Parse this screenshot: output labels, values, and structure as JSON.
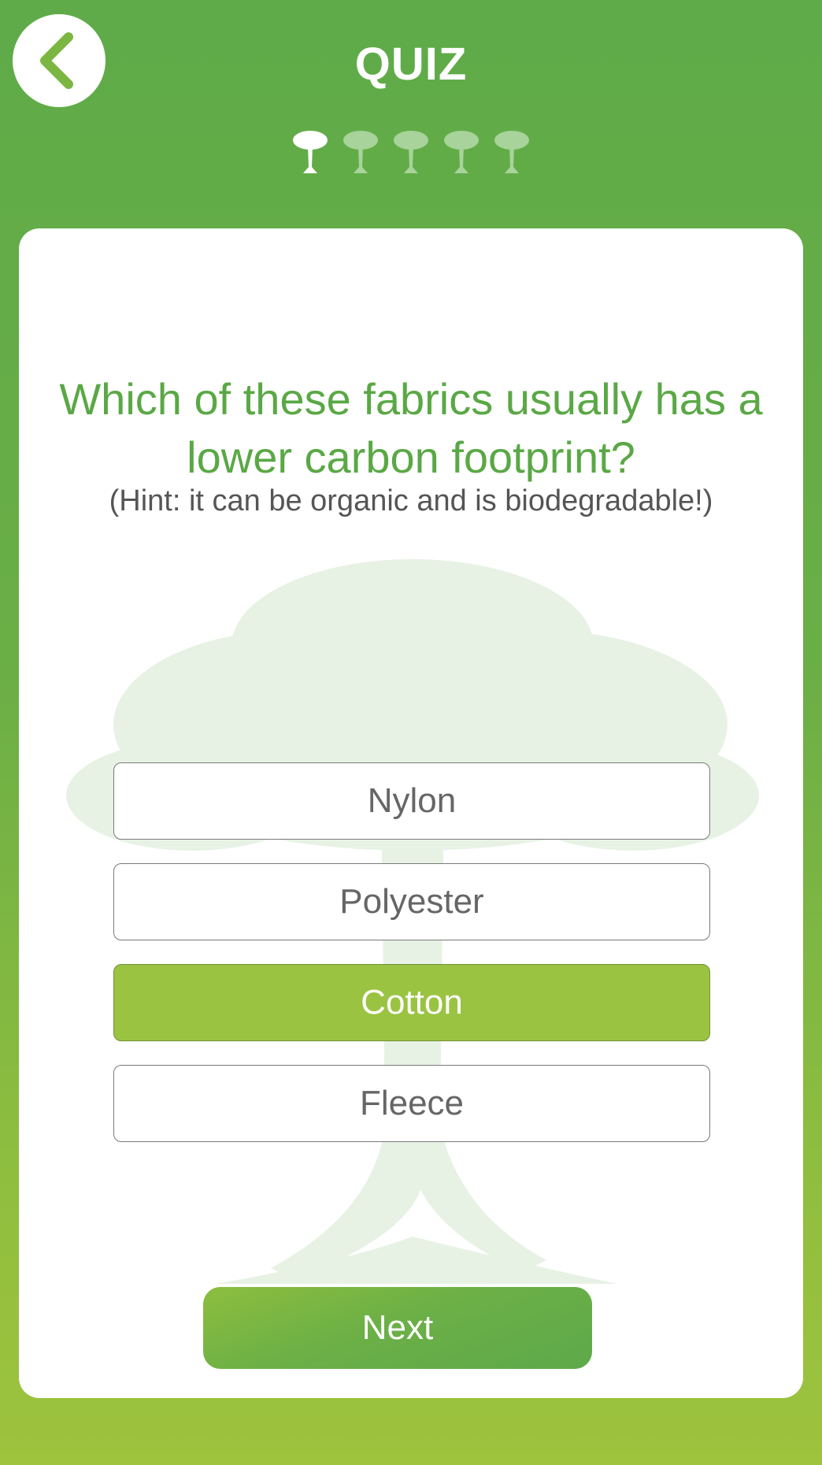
{
  "header": {
    "title": "QUIZ",
    "back_icon": "chevron-left-icon",
    "progress": {
      "total": 5,
      "current": 1,
      "icon": "tree-icon"
    }
  },
  "question": {
    "text": "Which of these fabrics usually has a lower carbon footprint?",
    "hint": "(Hint: it can be organic and is biodegradable!)"
  },
  "options": [
    {
      "label": "Nylon",
      "selected": false
    },
    {
      "label": "Polyester",
      "selected": false
    },
    {
      "label": "Cotton",
      "selected": true
    },
    {
      "label": "Fleece",
      "selected": false
    }
  ],
  "next_label": "Next",
  "colors": {
    "brand_green": "#5aa845",
    "selected_option": "#9ac342",
    "card_bg": "#ffffff"
  }
}
